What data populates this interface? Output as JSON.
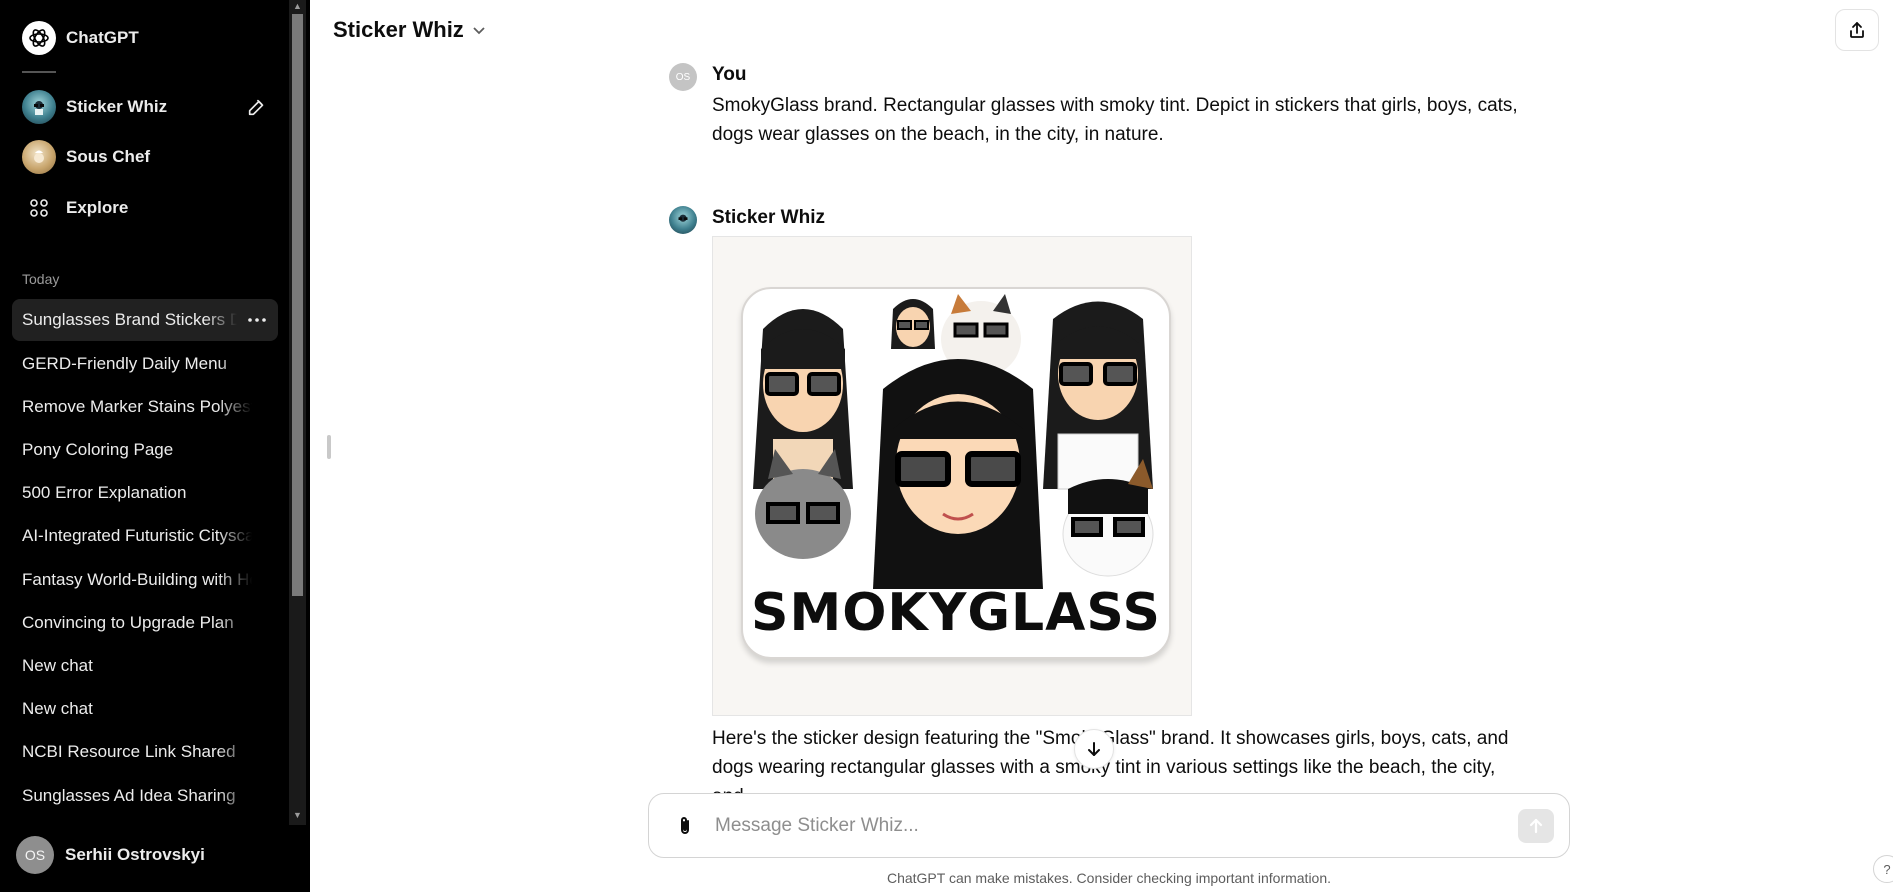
{
  "sidebar": {
    "app_name": "ChatGPT",
    "gpts": [
      {
        "label": "Sticker Whiz",
        "icon": "sticker-whiz-avatar"
      },
      {
        "label": "Sous Chef",
        "icon": "sous-chef-avatar"
      }
    ],
    "explore_label": "Explore",
    "section_today": "Today",
    "chats": [
      {
        "label": "Sunglasses Brand Stickers Design",
        "active": true
      },
      {
        "label": "GERD-Friendly Daily Menu"
      },
      {
        "label": "Remove Marker Stains Polyester"
      },
      {
        "label": "Pony Coloring Page"
      },
      {
        "label": "500 Error Explanation"
      },
      {
        "label": "AI-Integrated Futuristic Cityscape"
      },
      {
        "label": "Fantasy World-Building with Hobbits"
      },
      {
        "label": "Convincing to Upgrade Plan"
      },
      {
        "label": "New chat"
      },
      {
        "label": "New chat"
      },
      {
        "label": "NCBI Resource Link Shared"
      },
      {
        "label": "Sunglasses Ad Idea Sharing"
      }
    ],
    "user": {
      "initials": "OS",
      "name": "Serhii Ostrovskyi"
    }
  },
  "header": {
    "title": "Sticker Whiz"
  },
  "conversation": {
    "user_message": {
      "author": "You",
      "avatar_initials": "OS",
      "text": "SmokyGlass brand. Rectangular glasses with smoky tint. Depict in stickers that girls, boys, cats, dogs wear glasses on the beach, in the city, in nature."
    },
    "assistant_message": {
      "author": "Sticker Whiz",
      "image_brand_text": "SMOKYGLASS",
      "text": "Here's the sticker design featuring the \"SmokyGlass\" brand. It showcases girls, boys, cats, and dogs wearing rectangular glasses with a smoky tint in various settings like the beach, the city, and"
    }
  },
  "composer": {
    "placeholder": "Message Sticker Whiz..."
  },
  "disclaimer": "ChatGPT can make mistakes. Consider checking important information.",
  "help_label": "?"
}
